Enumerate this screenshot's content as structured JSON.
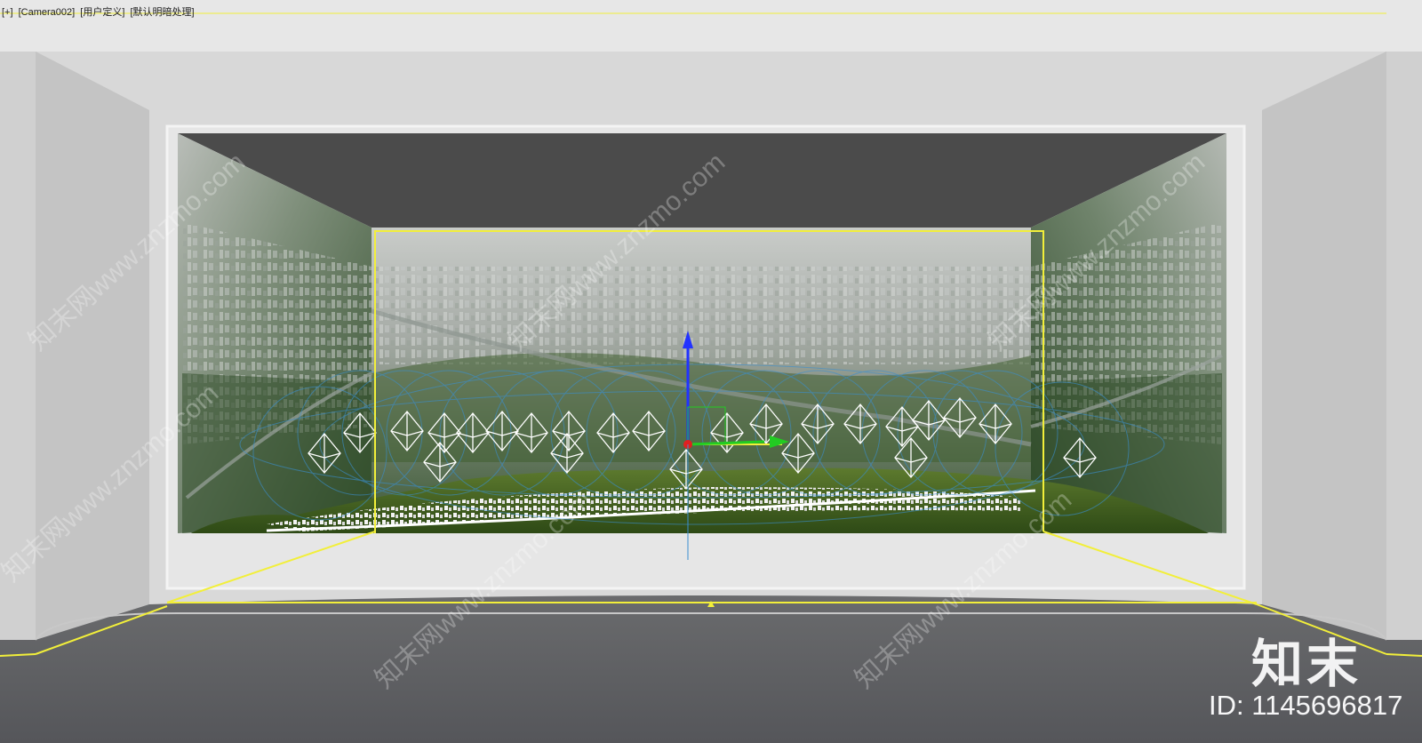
{
  "viewport": {
    "labels": [
      "[+]",
      "[Camera002]",
      "[用户定义]",
      "[默认明暗处理]"
    ]
  },
  "watermark": {
    "logo_text": "知末",
    "id_text": "ID: 1145696817",
    "site_text": "知末网www.znzmo.com"
  },
  "colors": {
    "ceiling_dark": "#4b4b4b",
    "wall_light": "#d8d8d8",
    "floor_dark": "#5c5d5f",
    "selection_yellow": "#f2ef3a",
    "gizmo_blue": "#2233ff",
    "gizmo_green": "#22cc22",
    "gizmo_red": "#e02020",
    "light_helper_white": "#ffffff",
    "light_range_blue": "#3a8fd0"
  },
  "icons": {
    "transform_gizmo": "move-gizmo-icon",
    "light_helper": "omni-light-icon"
  }
}
